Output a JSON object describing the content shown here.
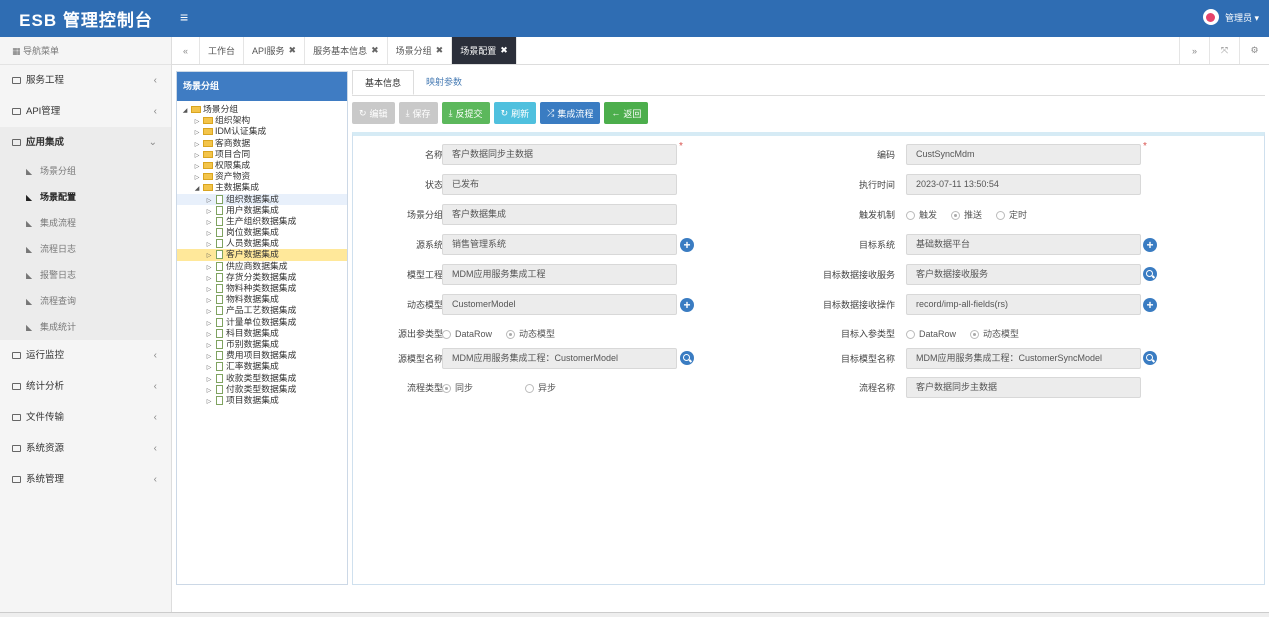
{
  "app": {
    "title": "ESB 管理控制台",
    "menu_toggle": "≡",
    "user": "管理员 ▾"
  },
  "sidebar": {
    "nav_header": "导航菜单",
    "groups_top": [
      {
        "label": "服务工程",
        "arrow": "‹"
      },
      {
        "label": "API管理",
        "arrow": "‹"
      },
      {
        "label": "应用集成",
        "arrow": "⌄"
      }
    ],
    "sub_items": [
      {
        "label": "场景分组"
      },
      {
        "label": "场景配置"
      },
      {
        "label": "集成流程"
      },
      {
        "label": "流程日志"
      },
      {
        "label": "报警日志"
      },
      {
        "label": "流程查询"
      },
      {
        "label": "集成统计"
      }
    ],
    "groups_bottom": [
      {
        "label": "运行监控",
        "arrow": "‹"
      },
      {
        "label": "统计分析",
        "arrow": "‹"
      },
      {
        "label": "文件传输",
        "arrow": "‹"
      },
      {
        "label": "系统资源",
        "arrow": "‹"
      },
      {
        "label": "系统管理",
        "arrow": "‹"
      }
    ]
  },
  "tabs": {
    "prev": "«",
    "next": "»",
    "expand": "⤧",
    "settings": "⚙",
    "close": "✖",
    "items": [
      {
        "label": "工作台"
      },
      {
        "label": "API服务"
      },
      {
        "label": "服务基本信息"
      },
      {
        "label": "场景分组"
      },
      {
        "label": "场景配置"
      }
    ]
  },
  "tree": {
    "title": "场景分组",
    "root": "场景分组",
    "folders": [
      "组织架构",
      "IDM认证集成",
      "客商数据",
      "项目合同",
      "权限集成",
      "资产物资"
    ],
    "main_folder": "主数据集成",
    "docs": [
      "组织数据集成",
      "用户数据集成",
      "生产组织数据集成",
      "岗位数据集成",
      "人员数据集成",
      "客户数据集成",
      "供应商数据集成",
      "存货分类数据集成",
      "物料种类数据集成",
      "物料数据集成",
      "产品工艺数据集成",
      "计量单位数据集成",
      "科目数据集成",
      "币别数据集成",
      "费用项目数据集成",
      "汇率数据集成",
      "收款类型数据集成",
      "付款类型数据集成",
      "项目数据集成"
    ]
  },
  "main": {
    "subtabs": [
      "基本信息",
      "映射参数"
    ],
    "buttons": {
      "edit": "编辑",
      "save": "保存",
      "unsubmit": "反提交",
      "refresh": "刷新",
      "flow": "集成流程",
      "back": "返回"
    },
    "form": {
      "name_label": "名称",
      "name_value": "客户数据同步主数据",
      "code_label": "编码",
      "code_value": "CustSyncMdm",
      "status_label": "状态",
      "status_value": "已发布",
      "exec_time_label": "执行时间",
      "exec_time_value": "2023-07-11 13:50:54",
      "group_label": "场景分组",
      "group_value": "客户数据集成",
      "trigger_label": "触发机制",
      "trigger_options": [
        "触发",
        "推送",
        "定时"
      ],
      "src_sys_label": "源系统",
      "src_sys_value": "销售管理系统",
      "tgt_sys_label": "目标系统",
      "tgt_sys_value": "基础数据平台",
      "model_proj_label": "模型工程",
      "model_proj_value": "MDM应用服务集成工程",
      "tgt_recv_label": "目标数据接收服务",
      "tgt_recv_value": "客户数据接收服务",
      "dyn_model_label": "动态模型",
      "dyn_model_value": "CustomerModel",
      "tgt_op_label": "目标数据接收操作",
      "tgt_op_value": "record/imp-all-fields(rs)",
      "src_out_label": "源出参类型",
      "src_out_options": [
        "DataRow",
        "动态模型"
      ],
      "tgt_in_label": "目标入参类型",
      "tgt_in_options": [
        "DataRow",
        "动态模型"
      ],
      "src_model_label": "源模型名称",
      "src_model_value": "MDM应用服务集成工程：CustomerModel",
      "tgt_model_label": "目标模型名称",
      "tgt_model_value": "MDM应用服务集成工程：CustomerSyncModel",
      "flow_type_label": "流程类型",
      "flow_type_options": [
        "同步",
        "异步"
      ],
      "flow_name_label": "流程名称",
      "flow_name_value": "客户数据同步主数据"
    }
  }
}
